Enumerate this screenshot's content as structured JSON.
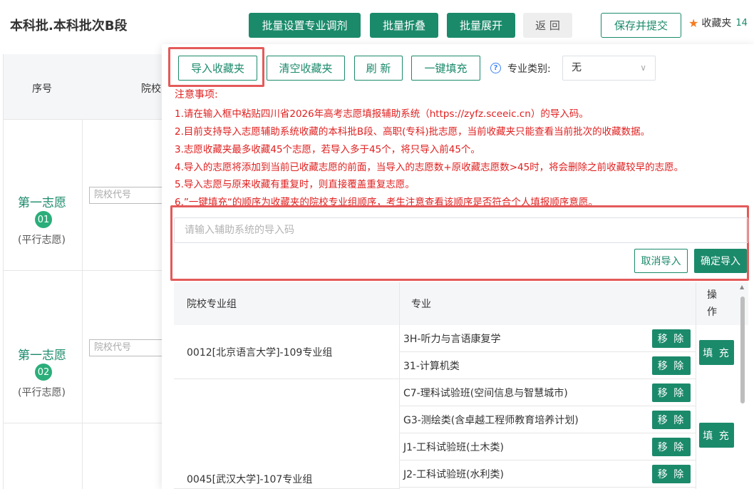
{
  "header": {
    "title": "本科批.本科批次B段",
    "buttons": [
      "批量设置专业调剂",
      "批量折叠",
      "批量展开"
    ],
    "back_label": "返 回",
    "save_label": "保存并提交",
    "favorites_label": "收藏夹",
    "favorites_count": "14"
  },
  "background_table": {
    "col_seq": "序号",
    "col_school": "院校",
    "rows": [
      {
        "title": "第一志愿",
        "num": "01",
        "sub": "(平行志愿)",
        "placeholder": "院校代号"
      },
      {
        "title": "第一志愿",
        "num": "02",
        "sub": "(平行志愿)",
        "placeholder": "院校代号"
      }
    ]
  },
  "panel": {
    "toolbar": {
      "import_fav": "导入收藏夹",
      "clear_fav": "清空收藏夹",
      "refresh": "刷 新",
      "one_click_fill": "一键填充",
      "category_label": "专业类别:",
      "category_value": "无"
    },
    "notes_title": "注意事项:",
    "notes": [
      "1.请在输入框中粘贴四川省2026年高考志愿填报辅助系统（https://zyfz.sceeic.cn）的导入码。",
      "2.目前支持导入志愿辅助系统收藏的本科批B段、高职(专科)批志愿，当前收藏夹只能查看当前批次的收藏数据。",
      "3.志愿收藏夹最多收藏45个志愿，若导入多于45个，将只导入前45个。",
      "4.导入的志愿将添加到当前已收藏志愿的前面，当导入的志愿数+原收藏志愿数>45时，将会删除之前收藏较早的志愿。",
      "5.导入志愿与原来收藏有重复时，则直接覆盖重复志愿。",
      "6.”一键填充“的顺序为收藏夹的院校专业组顺序，考生注意查看该顺序是否符合个人填报顺序意愿。"
    ],
    "import_placeholder": "请输入辅助系统的导入码",
    "cancel_import": "取消导入",
    "confirm_import": "确定导入",
    "table": {
      "col_group": "院校专业组",
      "col_major": "专业",
      "col_op": "操作",
      "remove_label": "移 除",
      "fill_label": "填 充",
      "groups": [
        {
          "name": "0012[北京语言大学]-109专业组",
          "majors": [
            "3H-听力与言语康复学",
            "31-计算机类"
          ]
        },
        {
          "name": "0045[武汉大学]-107专业组",
          "majors": [
            "C7-理科试验班(空间信息与智慧城市)",
            "G3-测绘类(含卓越工程师教育培养计划)",
            "J1-工科试验班(土木类)",
            "J2-工科试验班(水利类)"
          ]
        }
      ]
    }
  },
  "colors": {
    "primary": "#1b8a6b",
    "warning_text": "#e02020",
    "highlight_box": "#e45a5a",
    "star": "#f47c20"
  },
  "icons": [
    "star-icon",
    "question-icon",
    "chevron-down-icon"
  ]
}
